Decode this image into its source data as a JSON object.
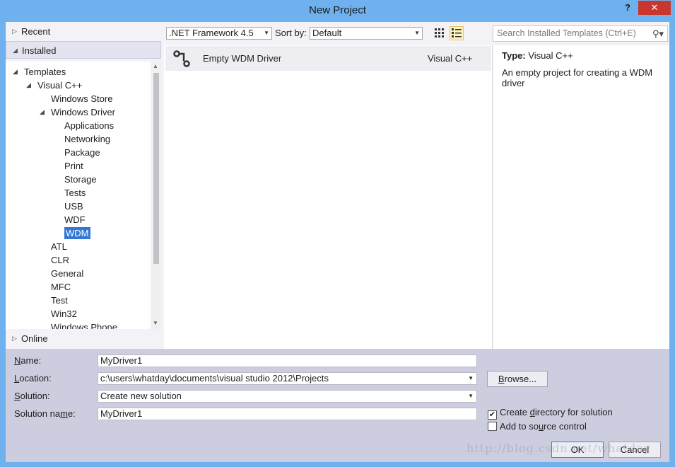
{
  "window": {
    "title": "New Project",
    "help": "?",
    "close": "✕"
  },
  "nav": {
    "recent": "Recent",
    "installed": "Installed",
    "online": "Online",
    "tree": [
      {
        "label": "Templates",
        "level": 0,
        "expanded": true
      },
      {
        "label": "Visual C++",
        "level": 1,
        "expanded": true
      },
      {
        "label": "Windows Store",
        "level": 2
      },
      {
        "label": "Windows Driver",
        "level": 2,
        "expanded": true
      },
      {
        "label": "Applications",
        "level": 3
      },
      {
        "label": "Networking",
        "level": 3
      },
      {
        "label": "Package",
        "level": 3
      },
      {
        "label": "Print",
        "level": 3
      },
      {
        "label": "Storage",
        "level": 3
      },
      {
        "label": "Tests",
        "level": 3
      },
      {
        "label": "USB",
        "level": 3
      },
      {
        "label": "WDF",
        "level": 3
      },
      {
        "label": "WDM",
        "level": 3,
        "selected": true
      },
      {
        "label": "ATL",
        "level": 2
      },
      {
        "label": "CLR",
        "level": 2
      },
      {
        "label": "General",
        "level": 2
      },
      {
        "label": "MFC",
        "level": 2
      },
      {
        "label": "Test",
        "level": 2
      },
      {
        "label": "Win32",
        "level": 2
      },
      {
        "label": "Windows Phone",
        "level": 2
      }
    ]
  },
  "toolbar": {
    "framework": ".NET Framework 4.5",
    "sort_by_label": "Sort by:",
    "sort_value": "Default",
    "search_placeholder": "Search Installed Templates (Ctrl+E)"
  },
  "templates": [
    {
      "name": "Empty WDM Driver",
      "language": "Visual C++",
      "icon": "driver-icon"
    }
  ],
  "details": {
    "type_label": "Type:",
    "type_value": "Visual C++",
    "description": "An empty project for creating a WDM driver"
  },
  "form": {
    "name_label": "Name:",
    "name_value": "MyDriver1",
    "location_label": "Location:",
    "location_value": "c:\\users\\whatday\\documents\\visual studio 2012\\Projects",
    "solution_label": "Solution:",
    "solution_value": "Create new solution",
    "solution_name_label": "Solution name:",
    "solution_name_value": "MyDriver1",
    "browse": "Browse...",
    "create_directory": "Create directory for solution",
    "create_directory_checked": true,
    "add_source_control": "Add to source control",
    "add_source_control_checked": false,
    "ok": "OK",
    "cancel": "Cancel"
  },
  "watermark": "http://blog.csdn.net/whatday",
  "colors": {
    "window_frame": "#6fb1ee",
    "close_button": "#c7372d",
    "selection": "#3478d4",
    "form_background": "#cdcde0"
  }
}
